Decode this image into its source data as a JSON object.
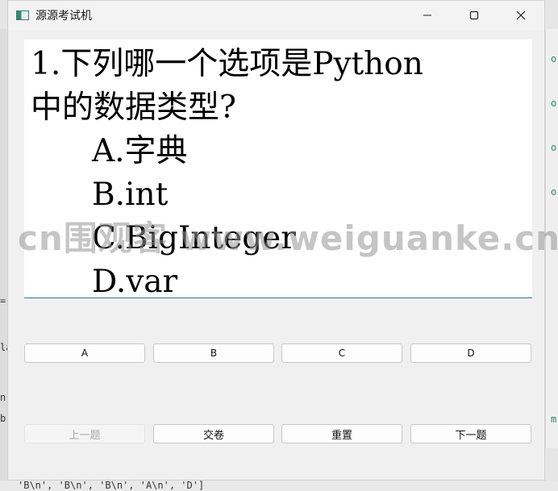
{
  "window": {
    "title": "源源考试机"
  },
  "question": {
    "line1": "1.下列哪一个选项是Python",
    "line2": "中的数据类型?",
    "options": [
      "A.字典",
      "B.int",
      "C.BigInteger",
      "D.var"
    ]
  },
  "watermark": "cn围观客 www.weiguanke.cn",
  "answer_buttons": [
    "A",
    "B",
    "C",
    "D"
  ],
  "nav_buttons": {
    "prev": "上一题",
    "submit": "交卷",
    "reset": "重置",
    "next": "下一题"
  },
  "background": {
    "right_chars": [
      "o",
      "o",
      "o",
      "o",
      "m"
    ],
    "left_chars": [
      "=",
      "la",
      "n",
      "b"
    ],
    "bottom_text": "'B\\n', 'B\\n', 'B\\n', 'A\\n', 'D']"
  },
  "colors": {
    "accent_underline": "#3b6fb6",
    "scrollbar": "#7d7d7d"
  }
}
